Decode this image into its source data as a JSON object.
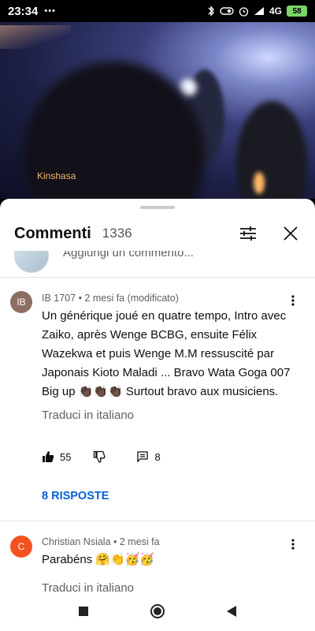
{
  "status_bar": {
    "time": "23:34",
    "dots": "•••",
    "network": "4G",
    "battery": "58"
  },
  "video": {
    "caption": "Kinshasa"
  },
  "comments_panel": {
    "title": "Commenti",
    "count": "1336",
    "add_comment_placeholder": "Aggiungi un commento..."
  },
  "comments": [
    {
      "avatar_initials": "IB",
      "avatar_color": "#8d6e63",
      "meta": "IB 1707 • 2 mesi fa (modificato)",
      "text": "Un générique joué en quatre tempo, Intro avec Zaiko, après Wenge BCBG, ensuite Félix Wazekwa et puis Wenge M.M ressuscité par Japonais Kioto Maladi ... Bravo Wata Goga 007 Big up 👏🏿👏🏿👏🏿 Surtout bravo aux musiciens.",
      "translate_label": "Traduci in italiano",
      "likes": "55",
      "reply_count": "8",
      "replies_label": "8 RISPOSTE"
    },
    {
      "avatar_initials": "C",
      "avatar_color": "#f4511e",
      "meta": "Christian Nsiala • 2 mesi fa",
      "text": "Parabéns 🤗👏🥳🥳",
      "translate_label": "Traduci in italiano"
    }
  ]
}
